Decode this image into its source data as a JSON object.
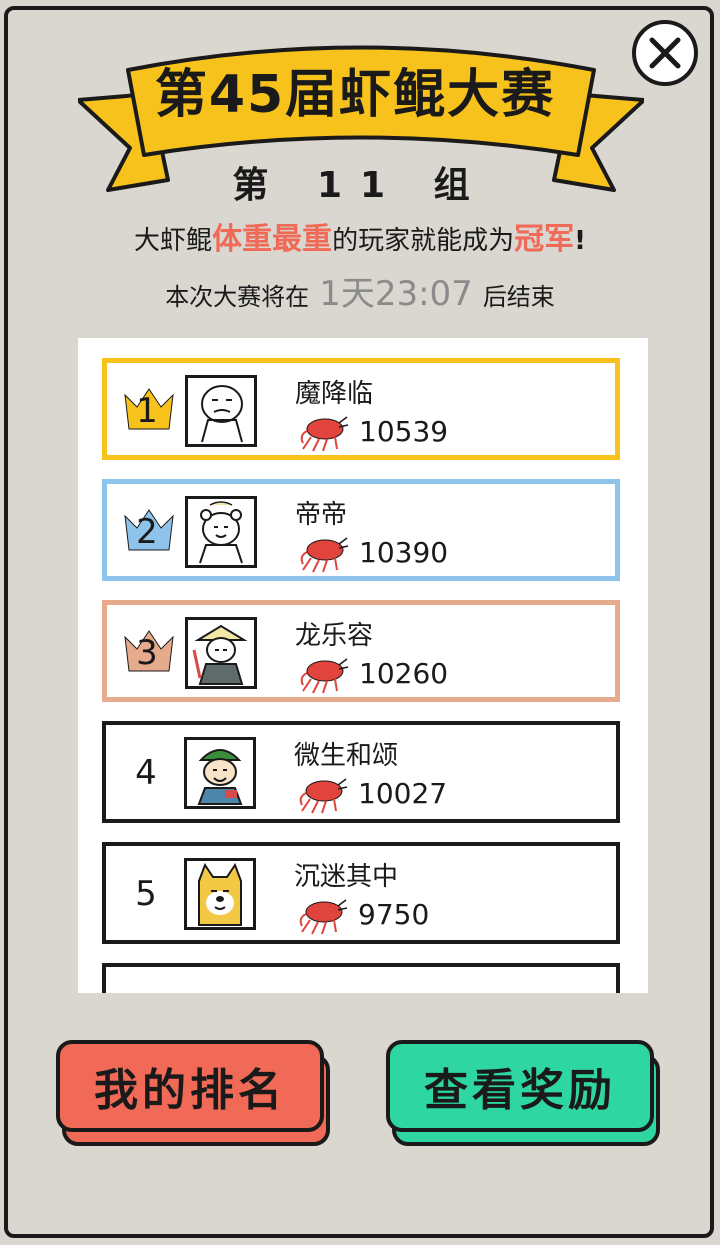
{
  "header": {
    "title": "第45届虾鲲大赛",
    "group": "第 11 组",
    "rule_prefix": "大虾鲲",
    "rule_highlight1": "体重最重",
    "rule_middle": "的玩家就能成为",
    "rule_highlight2": "冠军",
    "rule_suffix": "!",
    "timer_prefix": "本次大赛将在",
    "timer_value": "1天23:07",
    "timer_suffix": "后结束"
  },
  "ranking": [
    {
      "rank": "1",
      "name": "魔降临",
      "weight": "10539",
      "border_color": "#f7c21b",
      "crown_color": "#f7c21b"
    },
    {
      "rank": "2",
      "name": "帝帝",
      "weight": "10390",
      "border_color": "#8ec3ec",
      "crown_color": "#8ec3ec"
    },
    {
      "rank": "3",
      "name": "龙乐容",
      "weight": "10260",
      "border_color": "#e6aa8d",
      "crown_color": "#e6aa8d"
    },
    {
      "rank": "4",
      "name": "微生和颂",
      "weight": "10027",
      "border_color": "#1a1a1a"
    },
    {
      "rank": "5",
      "name": "沉迷其中",
      "weight": "9750",
      "border_color": "#1a1a1a"
    }
  ],
  "buttons": {
    "my_rank": "我的排名",
    "view_rewards": "查看奖励"
  },
  "colors": {
    "banner": "#f7c21b",
    "highlight": "#f06a57",
    "my_rank_bg": "#f06a57",
    "rewards_bg": "#2ed6a1"
  }
}
